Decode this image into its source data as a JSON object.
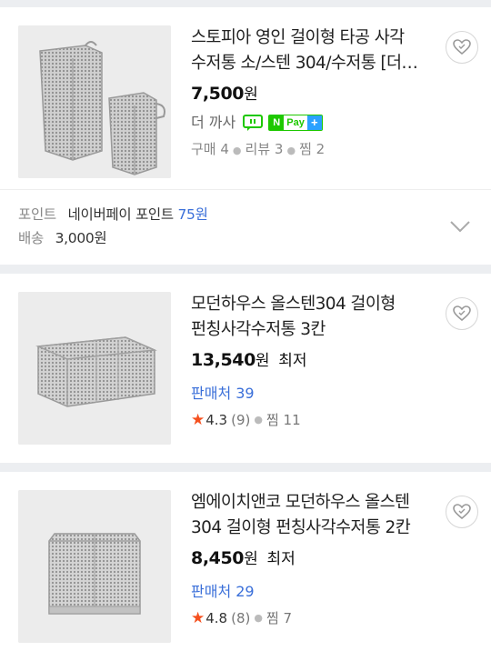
{
  "products": [
    {
      "title": "스토피아 영인 걸이형 타공 사각 수저통 소/스텐 304/수저통 [더…",
      "price": "7,500",
      "won": "원",
      "seller": "더 까사",
      "npay": {
        "n": "N",
        "pay": "Pay",
        "plus": "+"
      },
      "purchase": "구매 4",
      "review": "리뷰 3",
      "zzim": "찜 2"
    },
    {
      "title": "모던하우스 올스텐304 걸이형 펀칭사각수저통 3칸",
      "price": "13,540",
      "won": "원",
      "lowest": "최저",
      "sellers": "판매처 39",
      "rating": "4.3",
      "rating_count": "(9)",
      "zzim": "찜 11"
    },
    {
      "title": "엠에이치앤코 모던하우스 올스텐 304 걸이형 펀칭사각수저통 2칸",
      "price": "8,450",
      "won": "원",
      "lowest": "최저",
      "sellers": "판매처 29",
      "rating": "4.8",
      "rating_count": "(8)",
      "zzim": "찜 7"
    }
  ],
  "point_info": {
    "point_label": "포인트",
    "point_text": "네이버페이 포인트",
    "point_value": "75원",
    "shipping_label": "배송",
    "shipping_value": "3,000원"
  },
  "colors": {
    "link_blue": "#3a6fd9",
    "star": "#f5501e",
    "npay_green": "#1ec800",
    "separator": "#eceef1"
  }
}
